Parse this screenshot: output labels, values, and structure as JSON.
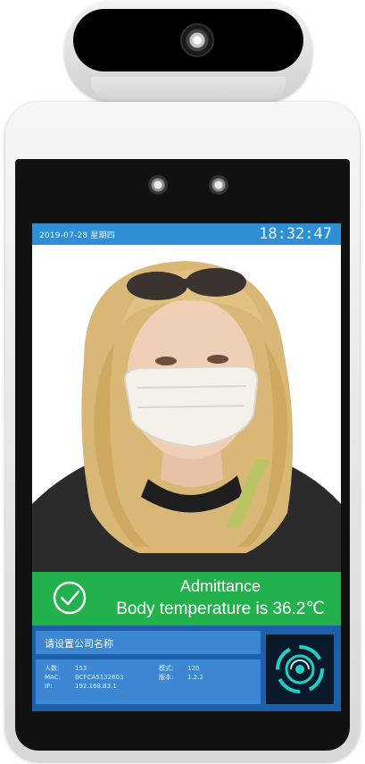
{
  "status_bar": {
    "date": "2019-07-28 星期四",
    "time": "18:32:47"
  },
  "banner": {
    "title": "Admittance",
    "subtitle": "Body temperature is 36.2℃",
    "icon": "check-circle-icon",
    "color": "#23b14d"
  },
  "info": {
    "company_name": "请设置公司名称",
    "people_label": "人数:",
    "people_value": "153",
    "mac_label": "MAC:",
    "mac_value": "BCFCA5132603",
    "ip_label": "IP:",
    "ip_value": "192.168.83.1",
    "model_label": "模式:",
    "model_value": "120",
    "version_label": "版本:",
    "version_value": "1.2.2",
    "scan_icon": "face-scan-icon"
  },
  "colors": {
    "status_bar": "#2f8fd4",
    "info_panel": "#1d5fa8",
    "info_box": "#3c86d2",
    "scan_accent": "#19d3c5"
  }
}
